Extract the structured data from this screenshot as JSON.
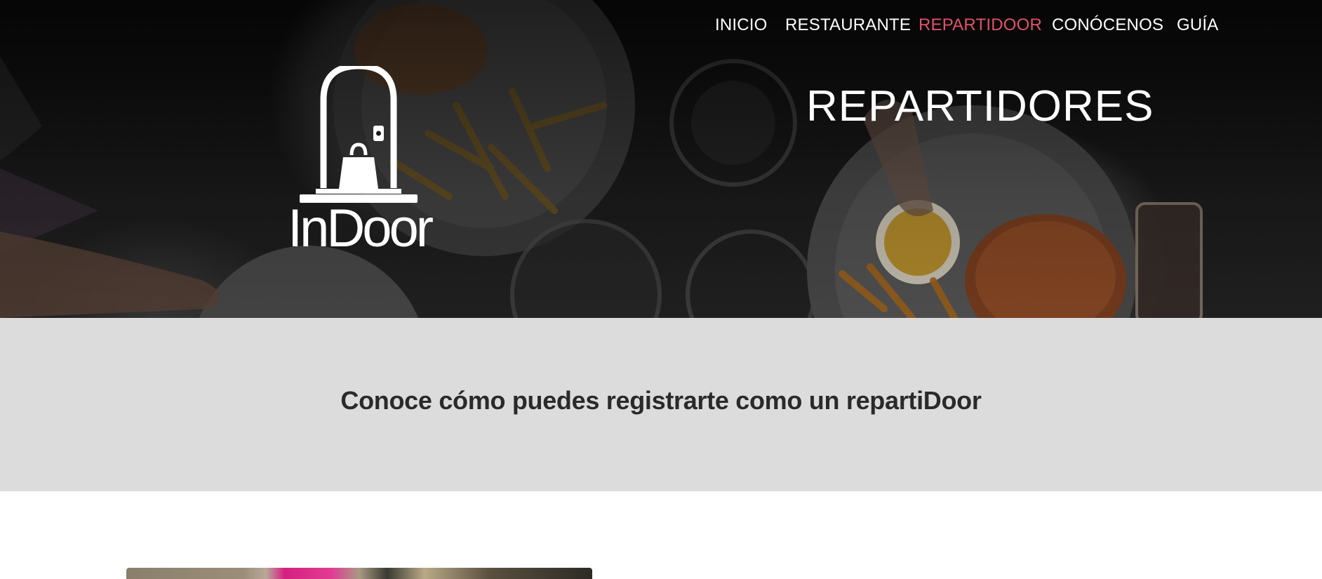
{
  "nav": {
    "items": [
      {
        "label": "INICIO"
      },
      {
        "label": "RESTAURANTE"
      },
      {
        "label": "REPARTIDOOR"
      },
      {
        "label": "CONÓCENOS"
      },
      {
        "label": "GUÍA"
      }
    ],
    "active_index": 2,
    "active_color": "#e0516a"
  },
  "logo": {
    "wordmark": "InDoor",
    "icon": "door-with-shopping-bag-icon"
  },
  "hero": {
    "title": "REPARTIDORES"
  },
  "band": {
    "text": "Conoce cómo puedes registrarte como un repartiDoor"
  },
  "colors": {
    "band_background": "#dcdcdc",
    "text_dark": "#2a2a2a"
  }
}
